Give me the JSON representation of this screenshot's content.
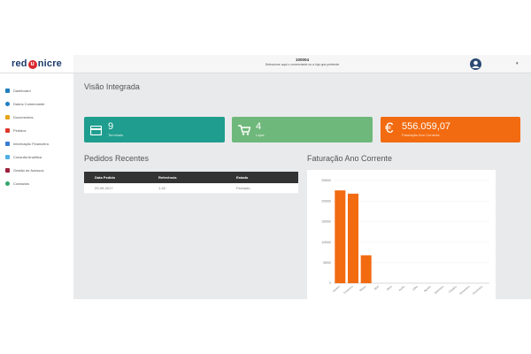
{
  "brand": {
    "logo_pre": "red",
    "logo_mid": "u",
    "logo_post": "nicre"
  },
  "topbar": {
    "store_code": "100004",
    "store_hint": "Seleccione aqui o comerciante ou a loja que pretende"
  },
  "sidebar": {
    "items": [
      {
        "label": "Dashboard",
        "icon": "dashboard-icon",
        "color": "#1f7fbf"
      },
      {
        "label": "Dados Comerciante",
        "icon": "user-icon",
        "color": "#1f7fbf"
      },
      {
        "label": "Documentos",
        "icon": "folder-icon",
        "color": "#e8a316"
      },
      {
        "label": "Pedidos",
        "icon": "cart-icon",
        "color": "#e0362b"
      },
      {
        "label": "Informação Financeira",
        "icon": "chart-icon",
        "color": "#3a7bd5"
      },
      {
        "label": "Consulta Analítica",
        "icon": "analytics-icon",
        "color": "#4fb0e8"
      },
      {
        "label": "Gestão de Acessos",
        "icon": "lock-icon",
        "color": "#9c1f3a"
      },
      {
        "label": "Contactos",
        "icon": "phone-icon",
        "color": "#33a36a"
      }
    ]
  },
  "main": {
    "title": "Visão Integrada",
    "tiles": [
      {
        "value": "9",
        "label": "Terminais",
        "color": "#1f9e8f",
        "icon": "card-icon"
      },
      {
        "value": "4",
        "label": "Lojas",
        "color": "#6fb87b",
        "icon": "cart-icon"
      },
      {
        "value": "556.059,07",
        "label": "Faturação Ano Corrente",
        "color": "#f26b10",
        "icon": "euro-icon"
      }
    ],
    "orders": {
      "title": "Pedidos Recentes",
      "columns": [
        "Data Pedido",
        "Referência",
        "Estado"
      ],
      "rows": [
        [
          "29-09-2017",
          "1-42",
          "Fechado"
        ]
      ]
    },
    "billing": {
      "title": "Faturação Ano Corrente"
    }
  },
  "chart_data": {
    "type": "bar",
    "categories": [
      "Janeiro",
      "Fevereiro",
      "Março",
      "Abril",
      "Maio",
      "Junho",
      "Julho",
      "Agosto",
      "Setembro",
      "Outubro",
      "Novembro",
      "Dezembro"
    ],
    "values": [
      226000,
      218000,
      68000,
      0,
      0,
      0,
      0,
      0,
      0,
      0,
      0,
      0
    ],
    "yticks": [
      "0",
      "50000",
      "100000",
      "150000",
      "200000",
      "250000"
    ],
    "ylim": [
      0,
      250000
    ],
    "bar_color": "#f26b10",
    "title": "",
    "xlabel": "",
    "ylabel": ""
  }
}
